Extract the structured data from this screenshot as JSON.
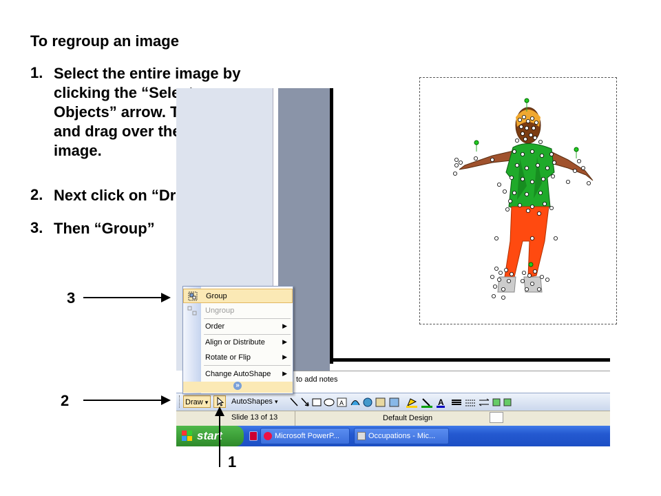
{
  "instructions": {
    "heading": "To regroup an image",
    "steps": [
      {
        "num": "1.",
        "text": "Select the entire image by clicking the “Select Objects” arrow. Then click and drag over the entire image."
      },
      {
        "num": "2.",
        "text": "Next click on “Draw”"
      },
      {
        "num": "3.",
        "text": "Then “Group”"
      }
    ]
  },
  "callouts": {
    "one": "1",
    "two": "2",
    "three": "3"
  },
  "menu": {
    "items": [
      {
        "label": "Group",
        "highlighted": true,
        "disabled": false,
        "submenu": false
      },
      {
        "label": "Ungroup",
        "highlighted": false,
        "disabled": true,
        "submenu": false
      },
      {
        "label": "Order",
        "highlighted": false,
        "disabled": false,
        "submenu": true
      },
      {
        "label": "Align or Distribute",
        "highlighted": false,
        "disabled": false,
        "submenu": true
      },
      {
        "label": "Rotate or Flip",
        "highlighted": false,
        "disabled": false,
        "submenu": true
      },
      {
        "label": "Change AutoShape",
        "highlighted": false,
        "disabled": false,
        "submenu": true
      }
    ],
    "submenu_arrow": "▶",
    "expand_glyph": "»"
  },
  "notes": {
    "placeholder": "to add notes"
  },
  "drawing_toolbar": {
    "draw": "Draw",
    "draw_caret": "▾",
    "autoshapes": "AutoShapes",
    "autoshapes_caret": "▾"
  },
  "status": {
    "slide": "Slide 13 of 13",
    "design": "Default Design"
  },
  "taskbar": {
    "start": "start",
    "buttons": [
      {
        "label": "Microsoft PowerP..."
      },
      {
        "label": "Occupations - Mic..."
      }
    ]
  },
  "colors": {
    "highlight": "#fbe9b5",
    "taskbar": "#2459d0",
    "start": "#3a9a35",
    "shirt": "#1faa2a",
    "pants": "#ff4a10"
  }
}
